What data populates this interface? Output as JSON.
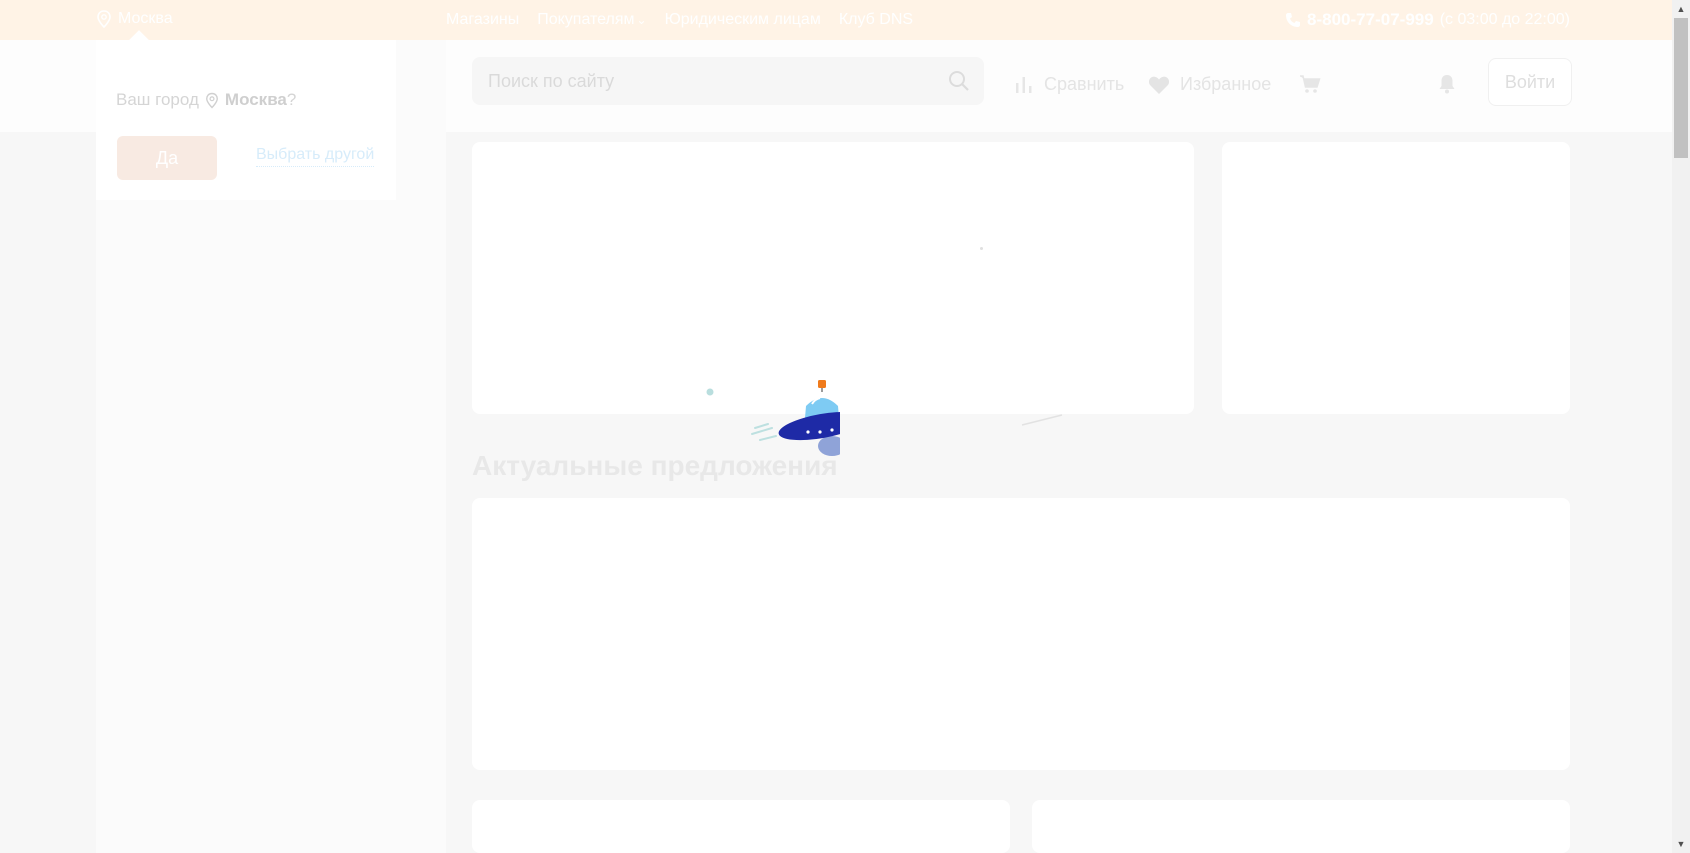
{
  "topbar": {
    "city": "Москва",
    "nav": [
      "Магазины",
      "Покупателям",
      "Юридическим лицам",
      "Клуб DNS"
    ],
    "phone": "8-800-77-07-999",
    "hours": "(с 03:00 до 22:00)"
  },
  "header": {
    "search_placeholder": "Поиск по сайту",
    "compare": "Сравнить",
    "favorites": "Избранное",
    "login": "Войти"
  },
  "city_popup": {
    "question_prefix": "Ваш город",
    "city": "Москва",
    "question_suffix": "?",
    "yes": "Да",
    "choose_other": "Выбрать другой"
  },
  "main": {
    "section_title": "Актуальные предложения"
  },
  "colors": {
    "topbar_bg": "#fff3e6",
    "ufo_body": "#1e2aa6",
    "ufo_dome": "#7ecbf3",
    "ufo_antenna": "#f07b1c"
  }
}
